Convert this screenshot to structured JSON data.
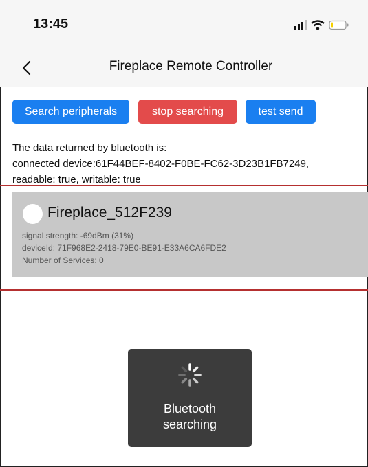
{
  "status_bar": {
    "time": "13:45",
    "signal_icon": "signal-bars-icon",
    "wifi_icon": "wifi-icon",
    "battery_icon": "battery-icon"
  },
  "nav": {
    "title": "Fireplace Remote Controller",
    "back_icon": "chevron-left-icon"
  },
  "buttons": {
    "search": "Search peripherals",
    "stop": "stop searching",
    "test": "test send"
  },
  "colors": {
    "primary": "#1a7ff0",
    "danger": "#e34b4b",
    "card": "#c8c8c8",
    "toast": "#3c3c3c"
  },
  "info": {
    "line1": "The data returned by bluetooth is:",
    "line2": "connected device:61F44BEF-8402-F0BE-FC62-3D23B1FB7249,",
    "line3": "readable: true, writable: true"
  },
  "device": {
    "name": "Fireplace_512F239",
    "signal": "signal strength: -69dBm (31%)",
    "device_id": "deviceId: 71F968E2-2418-79E0-BE91-E33A6CA6FDE2",
    "services": "Number of Services: 0"
  },
  "toast": {
    "line1": "Bluetooth",
    "line2": "searching",
    "icon": "loading-spinner-icon"
  }
}
